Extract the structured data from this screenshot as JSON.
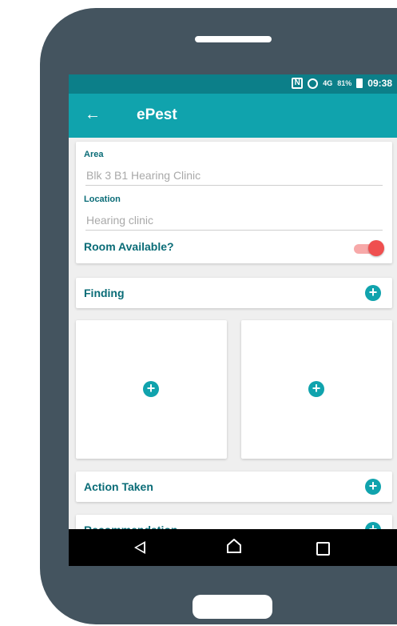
{
  "status_bar": {
    "nfc_icon": "nfc-icon",
    "alarm_icon": "alarm-icon",
    "network": "4G",
    "battery": "81%",
    "time": "09:38"
  },
  "app_bar": {
    "back_icon": "←",
    "title": "ePest"
  },
  "form": {
    "area_label": "Area",
    "area_value": "Blk 3 B1 Hearing Clinic",
    "location_label": "Location",
    "location_value": "Hearing clinic",
    "room_available_label": "Room Available?",
    "room_available_value": true
  },
  "sections": {
    "finding": "Finding",
    "action_taken": "Action Taken",
    "recommendation": "Recommendation"
  },
  "icons": {
    "add": "+"
  },
  "colors": {
    "status_bar": "#0c7f89",
    "app_bar": "#10a3ad",
    "label": "#0a6c77",
    "toggle_on": "#ef4f4f",
    "bezel": "#44545f"
  }
}
